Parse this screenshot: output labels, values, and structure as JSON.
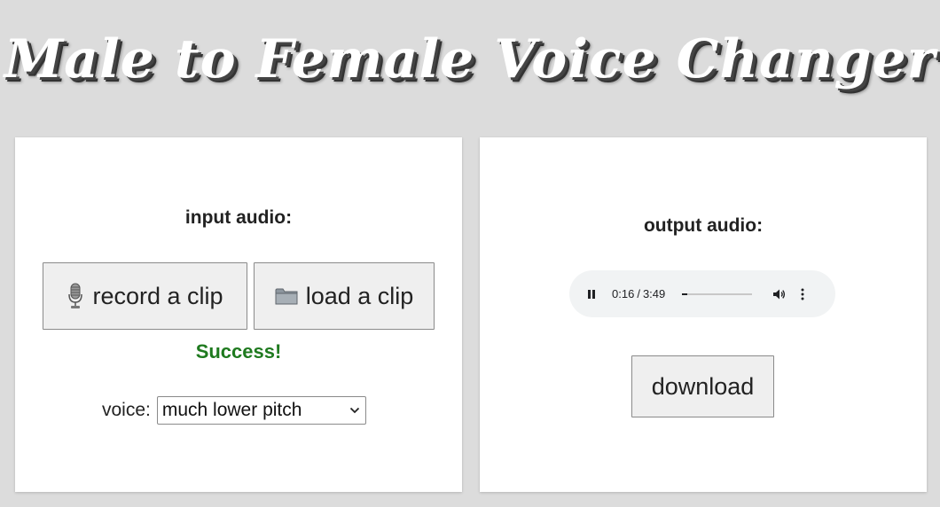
{
  "page": {
    "title": "Male to Female Voice Changer"
  },
  "input_panel": {
    "heading": "input audio:",
    "record_button": {
      "label": "record a clip",
      "icon": "microphone-icon"
    },
    "load_button": {
      "label": "load a clip",
      "icon": "folder-icon"
    },
    "status": "Success!",
    "voice": {
      "label": "voice:",
      "selected": "much lower pitch"
    }
  },
  "output_panel": {
    "heading": "output audio:",
    "player": {
      "state": "playing",
      "current_time": "0:16",
      "separator": "/",
      "duration": "3:49",
      "progress": 0.07
    },
    "download_button": {
      "label": "download"
    }
  },
  "colors": {
    "background": "#dcdcdc",
    "panel": "#ffffff",
    "success": "#1f7a1f",
    "button": "#efefef",
    "player": "#f1f3f4"
  }
}
